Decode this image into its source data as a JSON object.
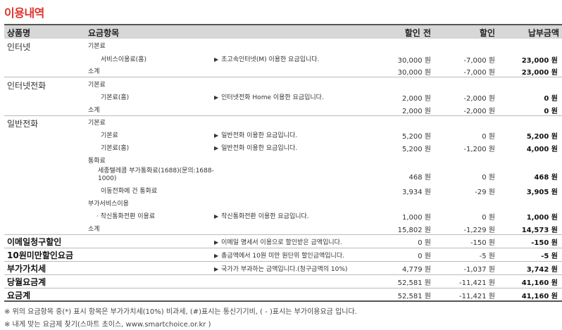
{
  "title": "이용내역",
  "header": {
    "product": "상품명",
    "item": "요금항목",
    "before": "할인 전",
    "discount": "할인",
    "payment": "납부금액"
  },
  "rows": [
    {
      "product": "인터넷",
      "item": "기본료",
      "desc": "",
      "before": "",
      "discount": "",
      "payment": ""
    },
    {
      "product": "",
      "item": "서비스이용료(홈)",
      "desc": "초고속인터넷(M) 이용한 요금입니다.",
      "before": "30,000 원",
      "discount": "-7,000 원",
      "payment": "23,000 원"
    },
    {
      "product": "",
      "item": "소계",
      "desc": "",
      "before": "30,000 원",
      "discount": "-7,000 원",
      "payment": "23,000 원"
    },
    {
      "product": "인터넷전화",
      "item": "기본료",
      "desc": "",
      "before": "",
      "discount": "",
      "payment": ""
    },
    {
      "product": "",
      "item": "기본료(홈)",
      "desc": "인터넷전화 Home 이용한 요금입니다.",
      "before": "2,000 원",
      "discount": "-2,000 원",
      "payment": "0 원"
    },
    {
      "product": "",
      "item": "소계",
      "desc": "",
      "before": "2,000 원",
      "discount": "-2,000 원",
      "payment": "0 원"
    },
    {
      "product": "일반전화",
      "item": "기본료",
      "desc": "",
      "before": "",
      "discount": "",
      "payment": ""
    },
    {
      "product": "",
      "item": "기본료",
      "desc": "일반전화 이용한 요금입니다.",
      "before": "5,200 원",
      "discount": "0 원",
      "payment": "5,200 원"
    },
    {
      "product": "",
      "item": "기본료(홈)",
      "desc": "일반전화 이용한 요금입니다.",
      "before": "5,200 원",
      "discount": "-1,200 원",
      "payment": "4,000 원"
    },
    {
      "product": "",
      "item": "통화료",
      "desc": "",
      "before": "",
      "discount": "",
      "payment": ""
    },
    {
      "product": "",
      "item": "세종텔레콤 부가통화료(1688)(문의:1688-1000)",
      "desc": "",
      "before": "468 원",
      "discount": "0 원",
      "payment": "468 원"
    },
    {
      "product": "",
      "item": "이동전화에 건 통화료",
      "desc": "",
      "before": "3,934 원",
      "discount": "-29 원",
      "payment": "3,905 원"
    },
    {
      "product": "",
      "item": "부가서비스이용",
      "desc": "",
      "before": "",
      "discount": "",
      "payment": ""
    },
    {
      "product": "",
      "item": "· 착신통화전환 이용료",
      "desc": "착신통화전환 이용한 요금입니다.",
      "before": "1,000 원",
      "discount": "0 원",
      "payment": "1,000 원"
    },
    {
      "product": "",
      "item": "소계",
      "desc": "",
      "before": "15,802 원",
      "discount": "-1,229 원",
      "payment": "14,573 원"
    },
    {
      "product": "이메일청구할인",
      "item": "",
      "desc": "이메일 명세서 이용으로 할인받은 금액입니다.",
      "before": "0 원",
      "discount": "-150 원",
      "payment": "-150 원"
    },
    {
      "product": "10원미만할인요금",
      "item": "",
      "desc": "총금액에서 10원 미만 원단위 할인금액입니다.",
      "before": "0 원",
      "discount": "-5 원",
      "payment": "-5 원"
    },
    {
      "product": "부가가치세",
      "item": "",
      "desc": "국가가 부과하는 금액입니다.(청구금액의 10%)",
      "before": "4,779 원",
      "discount": "-1,037 원",
      "payment": "3,742 원"
    },
    {
      "product": "당월요금계",
      "item": "",
      "desc": "",
      "before": "52,581 원",
      "discount": "-11,421 원",
      "payment": "41,160 원"
    },
    {
      "product": "요금계",
      "item": "",
      "desc": "",
      "before": "52,581 원",
      "discount": "-11,421 원",
      "payment": "41,160 원"
    }
  ],
  "notes": [
    "※ 위의 요금항목 중(*) 표시 항목은 부가가치세(10%) 비과세, (#)표시는 통신기기비, ( - )표시는 부가이용요금 입니다.",
    "※ 내게 맞는 요금제 찾기(스마트 초이스, www.smartchoice.or.kr )"
  ]
}
